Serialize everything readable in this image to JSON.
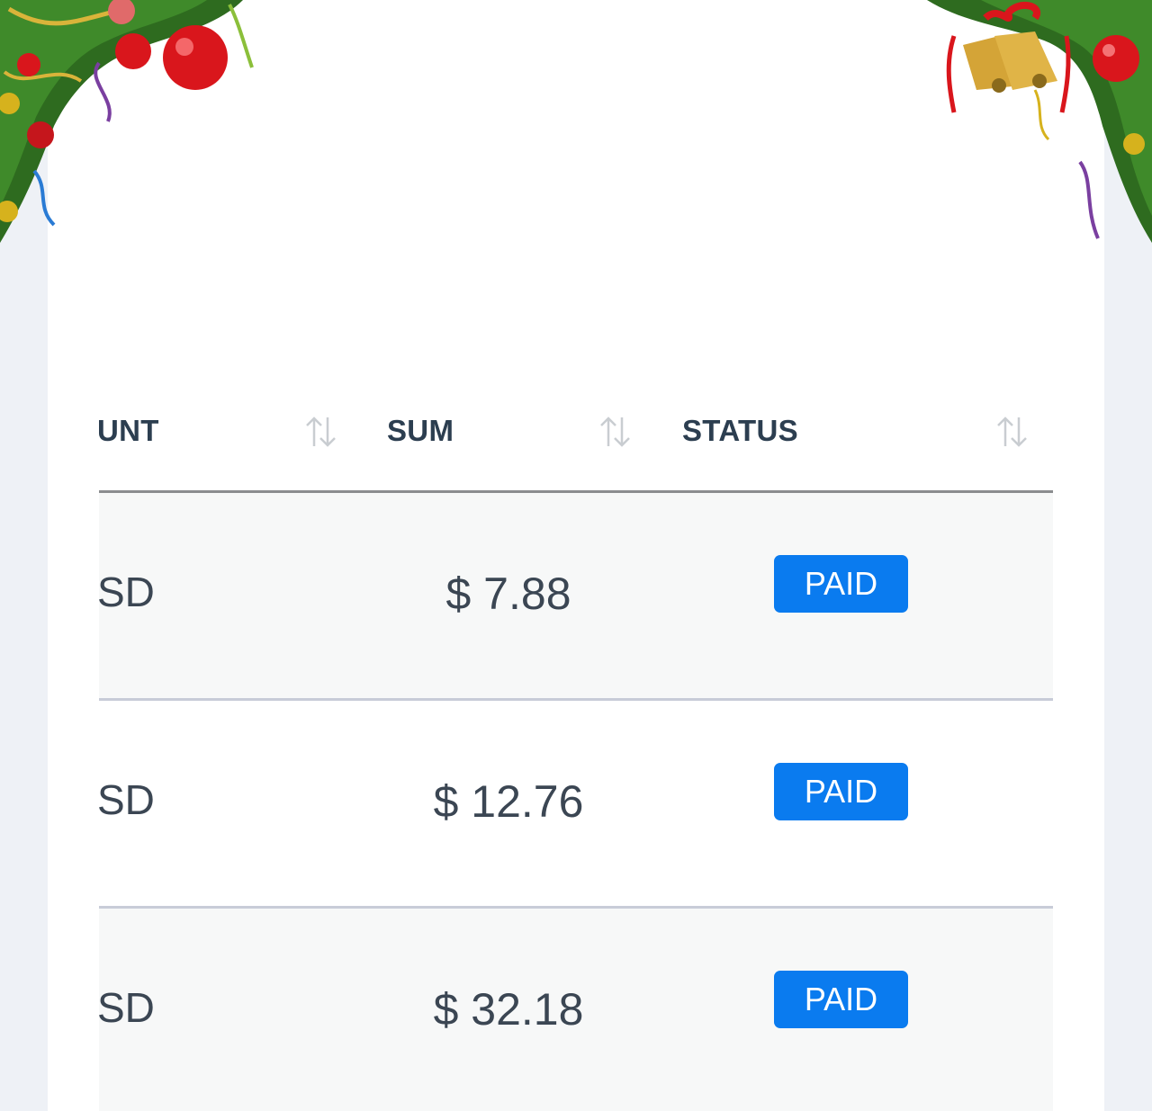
{
  "table": {
    "columns": [
      {
        "label": "UNT",
        "sort_icon": "sort-arrows-icon"
      },
      {
        "label": "SUM",
        "sort_icon": "sort-arrows-icon"
      },
      {
        "label": "STATUS",
        "sort_icon": "sort-arrows-icon"
      }
    ],
    "rows": [
      {
        "currency": "SD",
        "sum": "$ 7.88",
        "status": "PAID"
      },
      {
        "currency": "SD",
        "sum": "$ 12.76",
        "status": "PAID"
      },
      {
        "currency": "SD",
        "sum": "$ 32.18",
        "status": "PAID"
      }
    ]
  },
  "colors": {
    "status_paid": "#0a7bef",
    "page_background": "#eef1f6",
    "card_background": "#ffffff"
  },
  "decorations": [
    "christmas-garland-left",
    "christmas-bells-garland-right"
  ]
}
